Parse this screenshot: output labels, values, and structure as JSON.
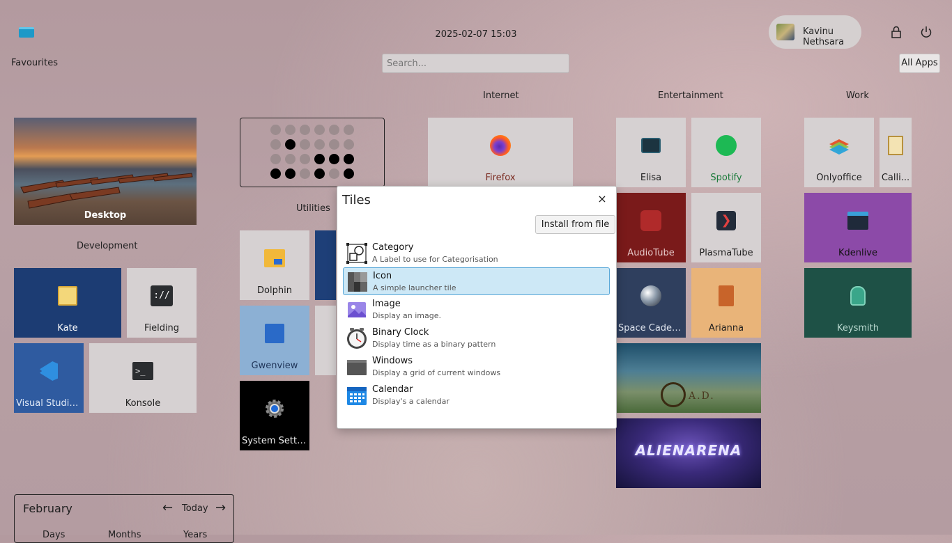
{
  "header": {
    "datetime": "2025-02-07 15:03",
    "search_placeholder": "Search...",
    "user": "Kavinu Nethsara",
    "all_apps": "All Apps",
    "favourites": "Favourites"
  },
  "categories": {
    "internet": "Internet",
    "entertainment": "Entertainment",
    "work": "Work",
    "utilities": "Utilities",
    "development": "Development"
  },
  "tiles": {
    "desktop": "Desktop",
    "firefox": "Firefox",
    "elisa": "Elisa",
    "spotify": "Spotify",
    "onlyoffice": "Onlyoffice",
    "calligra": "Calli...",
    "audiotube": "AudioTube",
    "plasmatube": "PlasmaTube",
    "kdenlive": "Kdenlive",
    "space": "Space Cadet ...",
    "arianna": "Arianna",
    "keysmith": "Keysmith",
    "kate": "Kate",
    "fielding": "Fielding",
    "vscode": "Visual Studio...",
    "konsole": "Konsole",
    "dolphin": "Dolphin",
    "gwenview": "Gwenview",
    "settings": "System Setti...",
    "ad_text": "A.D.",
    "alien_text": "ALIENARENA"
  },
  "binary_clock": {
    "bits": [
      [
        0,
        0,
        0,
        0,
        0,
        0
      ],
      [
        0,
        1,
        0,
        0,
        0,
        0
      ],
      [
        0,
        0,
        0,
        1,
        1,
        1
      ],
      [
        1,
        1,
        0,
        1,
        0,
        1
      ]
    ]
  },
  "calendar": {
    "month": "February",
    "today": "Today",
    "views": [
      "Days",
      "Months",
      "Years"
    ]
  },
  "dialog": {
    "title": "Tiles",
    "install": "Install from file",
    "items": [
      {
        "title": "Category",
        "desc": "A Label to use for Categorisation"
      },
      {
        "title": "Icon",
        "desc": "A simple launcher tile"
      },
      {
        "title": "Image",
        "desc": "Display an image."
      },
      {
        "title": "Binary Clock",
        "desc": "Display time as a binary pattern"
      },
      {
        "title": "Windows",
        "desc": "Display a grid of current windows"
      },
      {
        "title": "Calendar",
        "desc": "Display's a calendar"
      }
    ]
  },
  "colors": {
    "accent": "#3daee9",
    "selected_bg": "#cde8f6"
  }
}
